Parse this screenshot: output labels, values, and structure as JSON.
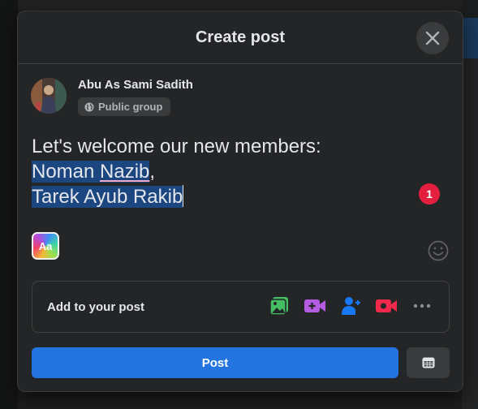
{
  "modal": {
    "title": "Create post"
  },
  "author": {
    "name": "Abu As Sami Sadith",
    "audience": "Public group",
    "audience_icon": "globe-icon"
  },
  "post": {
    "line1": "Let's welcome our new members:",
    "line2_word1": "Noman",
    "line2_word2": "Nazib",
    "line2_comma": ",",
    "line3": "Tarek Ayub Rakib"
  },
  "badge": {
    "count": "1"
  },
  "background_picker": {
    "label": "Aa"
  },
  "add_to_post": {
    "label": "Add to your post",
    "icons": [
      "photo-video-icon",
      "video-icon",
      "tag-people-icon",
      "live-video-icon",
      "more-icon"
    ]
  },
  "actions": {
    "post_label": "Post",
    "schedule_icon": "calendar-icon"
  },
  "colors": {
    "accent": "#2374e1",
    "modal_bg": "#242526",
    "selection": "#1c4680",
    "badge": "#e41e3f"
  }
}
